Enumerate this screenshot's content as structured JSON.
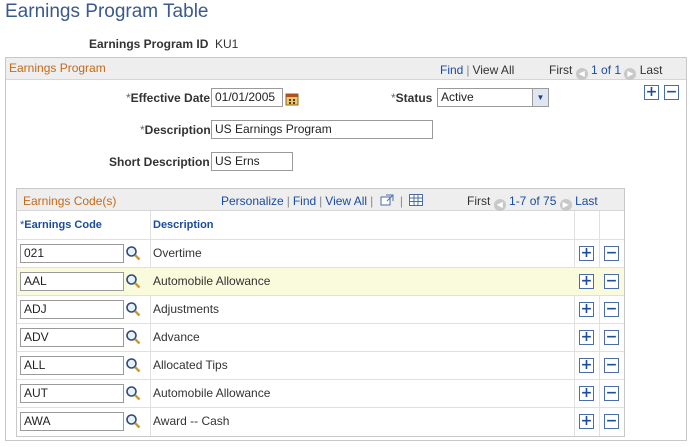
{
  "page": {
    "title": "Earnings Program Table"
  },
  "header": {
    "program_id_label": "Earnings Program ID",
    "program_id_value": "KU1"
  },
  "earnings_program": {
    "title": "Earnings Program",
    "nav": {
      "find": "Find",
      "view_all": "View All",
      "first": "First",
      "position": "1 of 1",
      "last": "Last"
    },
    "effective_date_label": "Effective Date",
    "effective_date_value": "01/01/2005",
    "status_label": "Status",
    "status_value": "Active",
    "description_label": "Description",
    "description_value": "US Earnings Program",
    "short_description_label": "Short Description",
    "short_description_value": "US Erns",
    "required_mark": "*"
  },
  "earnings_codes": {
    "title": "Earnings Code(s)",
    "nav": {
      "personalize": "Personalize",
      "find": "Find",
      "view_all": "View All",
      "first": "First",
      "position": "1-7 of 75",
      "last": "Last"
    },
    "columns": {
      "code": "Earnings Code",
      "description": "Description"
    },
    "rows": [
      {
        "code": "021",
        "description": "Overtime"
      },
      {
        "code": "AAL",
        "description": "Automobile Allowance"
      },
      {
        "code": "ADJ",
        "description": "Adjustments"
      },
      {
        "code": "ADV",
        "description": "Advance"
      },
      {
        "code": "ALL",
        "description": "Allocated Tips"
      },
      {
        "code": "AUT",
        "description": "Automobile Allowance"
      },
      {
        "code": "AWA",
        "description": "Award -- Cash"
      }
    ]
  },
  "icons": {
    "add": "+",
    "remove": "−",
    "prev": "◀",
    "next": "▶",
    "lookup": "magnifier-icon",
    "calendar": "calendar-icon",
    "dropdown": "▼"
  },
  "colors": {
    "title": "#3a5a8a",
    "link": "#1a4ca0",
    "section_title": "#c46a1a",
    "highlight_row": "#fafadc"
  }
}
